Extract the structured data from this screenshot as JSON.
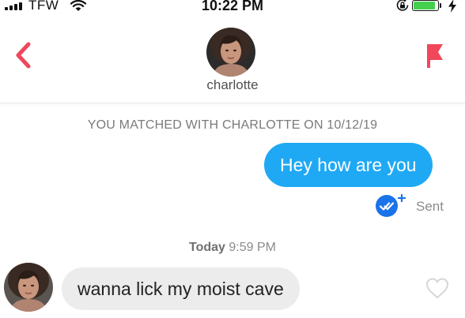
{
  "status_bar": {
    "carrier": "TFW",
    "time": "10:22 PM",
    "battery_color": "#44d04e",
    "battery_level": 0.9,
    "icons": [
      "signal-bars-icon",
      "wifi-icon",
      "rotation-lock-icon",
      "battery-icon",
      "charging-bolt-icon"
    ]
  },
  "header": {
    "match_name": "charlotte",
    "back_icon": "chevron-left-icon",
    "report_icon": "flag-icon",
    "accent_color": "#f0475b"
  },
  "conversation": {
    "match_banner": "YOU MATCHED WITH CHARLOTTE ON 10/12/19",
    "messages": [
      {
        "direction": "outgoing",
        "text": "Hey how are you",
        "status": "Sent",
        "status_icon": "double-check-icon",
        "bubble_color": "#1fa9f4"
      },
      {
        "direction": "incoming",
        "day": "Today",
        "time": "9:59 PM",
        "text": "wanna lick my moist cave",
        "like_icon": "heart-outline-icon",
        "bubble_color": "#ececec"
      }
    ]
  }
}
